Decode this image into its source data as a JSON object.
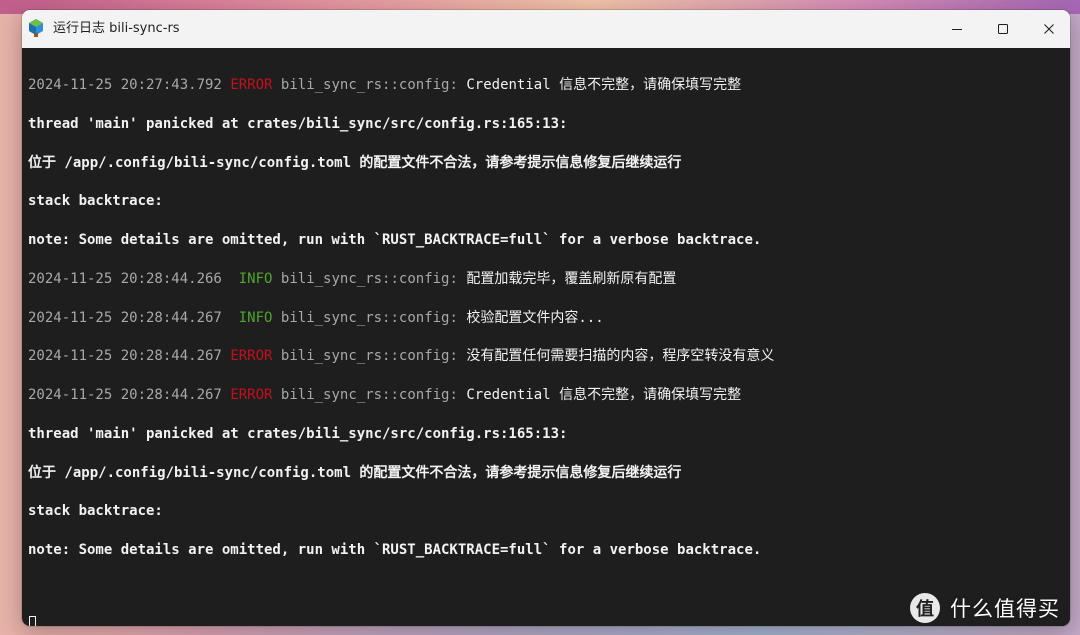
{
  "window": {
    "title": "运行日志 bili-sync-rs",
    "controls": {
      "minimize_icon": "minimize-icon",
      "maximize_icon": "maximize-icon",
      "close_icon": "close-icon"
    }
  },
  "colors": {
    "terminal_bg": "#1e1e1e",
    "error": "#c50f1f",
    "info": "#4fa62d",
    "timestamp": "#a8a8a8",
    "text": "#f2f2f2"
  },
  "log": [
    {
      "kind": "log",
      "timestamp": "2024-11-25 20:27:43.792",
      "level": "ERROR",
      "module": "bili_sync_rs::config:",
      "message": "Credential 信息不完整，请确保填写完整"
    },
    {
      "kind": "plain",
      "text": "thread 'main' panicked at crates/bili_sync/src/config.rs:165:13:"
    },
    {
      "kind": "plain",
      "text": "位于 /app/.config/bili-sync/config.toml 的配置文件不合法，请参考提示信息修复后继续运行"
    },
    {
      "kind": "plain",
      "text": "stack backtrace:"
    },
    {
      "kind": "plain",
      "text": "note: Some details are omitted, run with `RUST_BACKTRACE=full` for a verbose backtrace."
    },
    {
      "kind": "log",
      "timestamp": "2024-11-25 20:28:44.266",
      "level": " INFO",
      "module": "bili_sync_rs::config:",
      "message": "配置加载完毕，覆盖刷新原有配置"
    },
    {
      "kind": "log",
      "timestamp": "2024-11-25 20:28:44.267",
      "level": " INFO",
      "module": "bili_sync_rs::config:",
      "message": "校验配置文件内容..."
    },
    {
      "kind": "log",
      "timestamp": "2024-11-25 20:28:44.267",
      "level": "ERROR",
      "module": "bili_sync_rs::config:",
      "message": "没有配置任何需要扫描的内容，程序空转没有意义"
    },
    {
      "kind": "log",
      "timestamp": "2024-11-25 20:28:44.267",
      "level": "ERROR",
      "module": "bili_sync_rs::config:",
      "message": "Credential 信息不完整，请确保填写完整"
    },
    {
      "kind": "plain",
      "text": "thread 'main' panicked at crates/bili_sync/src/config.rs:165:13:"
    },
    {
      "kind": "plain",
      "text": "位于 /app/.config/bili-sync/config.toml 的配置文件不合法，请参考提示信息修复后继续运行"
    },
    {
      "kind": "plain",
      "text": "stack backtrace:"
    },
    {
      "kind": "plain",
      "text": "note: Some details are omitted, run with `RUST_BACKTRACE=full` for a verbose backtrace."
    }
  ],
  "watermark": {
    "badge": "值",
    "text": "什么值得买"
  }
}
